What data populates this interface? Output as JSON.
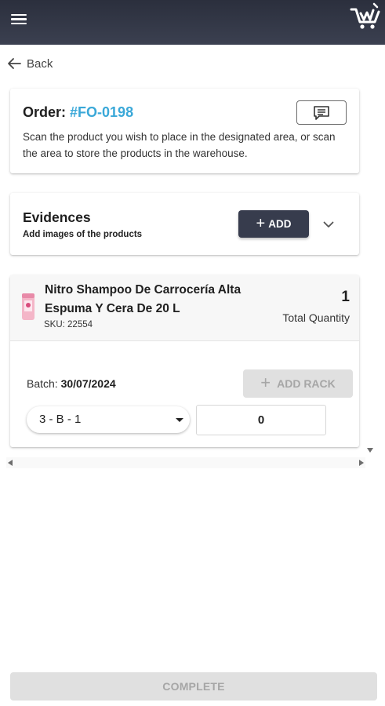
{
  "header": {
    "menu_icon": "hamburger-menu-icon",
    "logo_icon": "shopping-cart-logo-icon",
    "background": "#2f3443"
  },
  "nav": {
    "back_label": "Back",
    "back_icon": "arrow-left-icon"
  },
  "order": {
    "title_label": "Order:",
    "number": "#FO-0198",
    "description": "Scan the product you wish to place in the designated area, or scan the area to store the products in the warehouse.",
    "comment_icon": "comment-icon",
    "number_color": "#3aa8d8"
  },
  "evidences": {
    "title": "Evidences",
    "subtitle": "Add images of the products",
    "add_label": "ADD",
    "add_icon": "plus-icon",
    "expand_icon": "chevron-down-icon"
  },
  "product": {
    "name": "Nitro Shampoo De Carrocería Alta Espuma Y Cera De 20 L",
    "sku": "SKU: 22554",
    "quantity": "1",
    "quantity_label": "Total Quantity",
    "batch_label": "Batch:",
    "batch_value": "30/07/2024",
    "add_rack_label": "ADD RACK",
    "rack_selected": "3 - B - 1",
    "rack_quantity": "0"
  },
  "footer": {
    "complete_label": "COMPLETE"
  },
  "colors": {
    "primary_button": "#373c4d",
    "disabled_button": "#e0e0e0",
    "disabled_text": "#a6a6a6"
  }
}
